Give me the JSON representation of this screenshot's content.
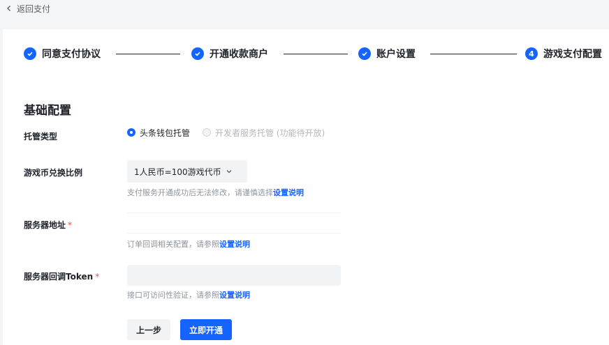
{
  "header": {
    "back_label": "返回支付"
  },
  "steps": [
    {
      "label": "同意支付协议",
      "status": "done"
    },
    {
      "label": "开通收款商户",
      "status": "done"
    },
    {
      "label": "账户设置",
      "status": "done"
    },
    {
      "label": "游戏支付配置",
      "status": "current",
      "number": "4"
    }
  ],
  "form": {
    "section_title": "基础配置",
    "hosting_type": {
      "label": "托管类型",
      "options": [
        {
          "label": "头条钱包托管",
          "selected": true,
          "disabled": false
        },
        {
          "label": "开发者服务托管 (功能待开放)",
          "selected": false,
          "disabled": true
        }
      ]
    },
    "exchange_ratio": {
      "label": "游戏币兑换比例",
      "value": "1人民币=100游戏代币",
      "hint": "支付服务开通成功后无法修改，请谨慎选择",
      "hint_link": "设置说明"
    },
    "server_address": {
      "label": "服务器地址",
      "required_mark": "*",
      "value": "",
      "hint": "订单回调相关配置，请参照",
      "hint_link": "设置说明"
    },
    "callback_token": {
      "label": "服务器回调Token",
      "required_mark": "*",
      "value": "",
      "hint": "接口可访问性验证，请参照",
      "hint_link": "设置说明"
    }
  },
  "actions": {
    "prev_label": "上一步",
    "submit_label": "立即开通"
  },
  "colors": {
    "primary": "#1664ff",
    "required": "#f54a45",
    "hint": "#8f959e"
  }
}
